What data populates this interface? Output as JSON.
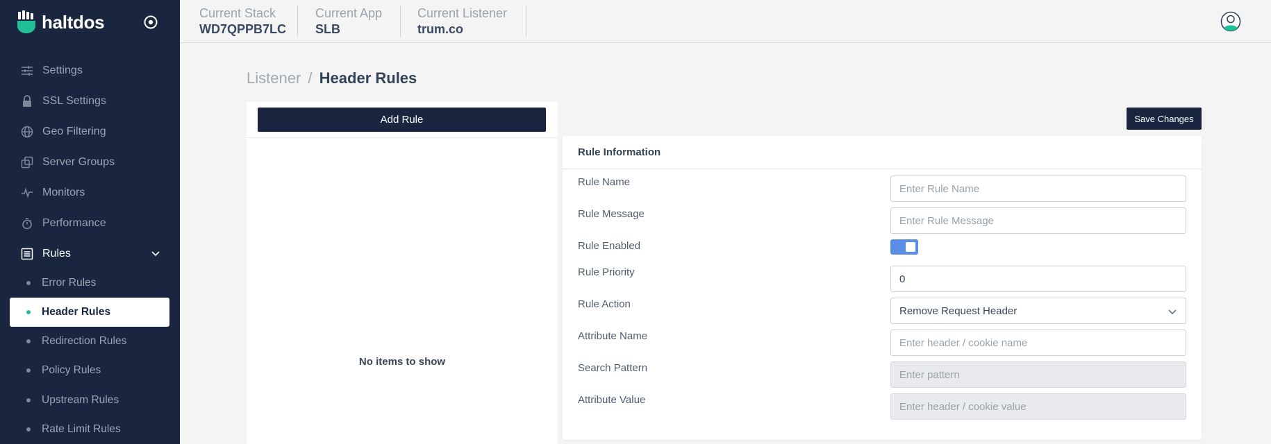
{
  "brand": {
    "name": "haltdos"
  },
  "sidebar": {
    "items": [
      {
        "label": "Settings",
        "icon": "sliders-icon"
      },
      {
        "label": "SSL Settings",
        "icon": "lock-icon"
      },
      {
        "label": "Geo Filtering",
        "icon": "globe-icon"
      },
      {
        "label": "Server Groups",
        "icon": "server-groups-icon"
      },
      {
        "label": "Monitors",
        "icon": "pulse-icon"
      },
      {
        "label": "Performance",
        "icon": "stopwatch-icon"
      },
      {
        "label": "Rules",
        "icon": "list-icon",
        "expanded": true
      }
    ],
    "sub_items": [
      {
        "label": "Error Rules"
      },
      {
        "label": "Header Rules",
        "selected": true
      },
      {
        "label": "Redirection Rules"
      },
      {
        "label": "Policy Rules"
      },
      {
        "label": "Upstream Rules"
      },
      {
        "label": "Rate Limit Rules"
      }
    ]
  },
  "header": {
    "stack_label": "Current Stack",
    "stack_value": "WD7QPPB7LC",
    "app_label": "Current App",
    "app_value": "SLB",
    "listener_label": "Current Listener",
    "listener_value": "trum.co"
  },
  "breadcrumb": {
    "parent": "Listener",
    "separator": "/",
    "current": "Header Rules"
  },
  "list_panel": {
    "add_label": "Add Rule",
    "empty_text": "No items to show"
  },
  "toolbar": {
    "save_label": "Save Changes"
  },
  "form": {
    "title": "Rule Information",
    "rule_name_label": "Rule Name",
    "rule_name_placeholder": "Enter Rule Name",
    "rule_message_label": "Rule Message",
    "rule_message_placeholder": "Enter Rule Message",
    "rule_enabled_label": "Rule Enabled",
    "rule_enabled": true,
    "rule_priority_label": "Rule Priority",
    "rule_priority_value": "0",
    "rule_action_label": "Rule Action",
    "rule_action_value": "Remove Request Header",
    "attribute_name_label": "Attribute Name",
    "attribute_name_placeholder": "Enter header / cookie name",
    "search_pattern_label": "Search Pattern",
    "search_pattern_placeholder": "Enter pattern",
    "attribute_value_label": "Attribute Value",
    "attribute_value_placeholder": "Enter header / cookie value"
  },
  "colors": {
    "sidebar_bg": "#1a2640",
    "accent": "#1fbf98",
    "toggle_on": "#5a8de6",
    "page_bg": "#f3f4f3"
  }
}
